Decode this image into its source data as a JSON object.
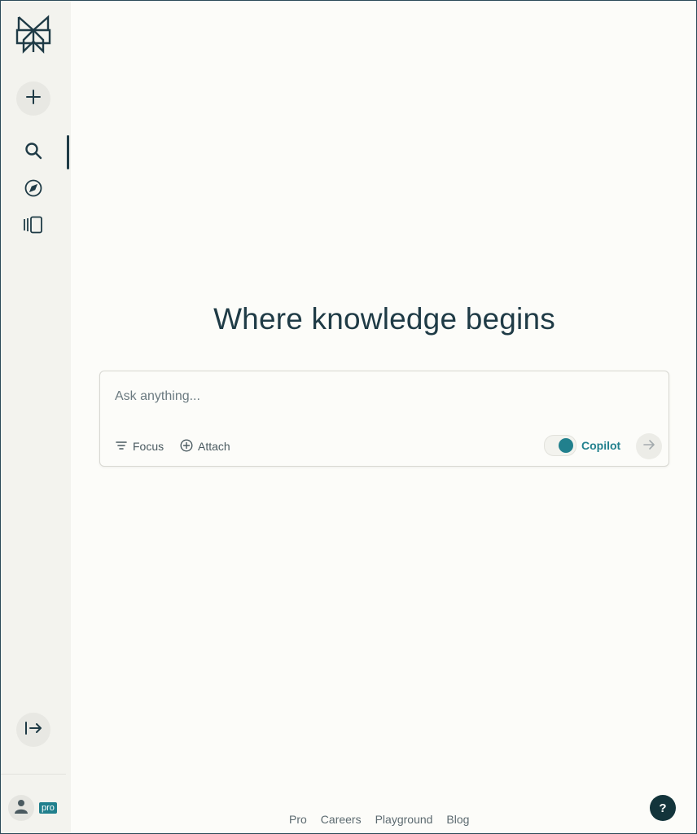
{
  "sidebar": {
    "logo_icon": "perplexity-logo-icon",
    "new_thread_icon": "plus-icon",
    "nav": [
      {
        "name": "search",
        "icon": "search-icon",
        "active": true
      },
      {
        "name": "discover",
        "icon": "compass-icon",
        "active": false
      },
      {
        "name": "library",
        "icon": "library-icon",
        "active": false
      }
    ],
    "collapse_icon": "expand-arrow-icon",
    "user_icon": "user-icon",
    "pro_badge": "pro"
  },
  "main": {
    "headline": "Where knowledge begins",
    "search": {
      "placeholder": "Ask anything...",
      "value": "",
      "focus_label": "Focus",
      "attach_label": "Attach",
      "copilot_label": "Copilot",
      "copilot_enabled": true
    }
  },
  "footer": {
    "links": [
      "Pro",
      "Careers",
      "Playground",
      "Blog"
    ],
    "help_label": "?"
  },
  "colors": {
    "accent": "#21808d",
    "text_dark": "#1f3b46",
    "sidebar_bg": "#f3f3ee",
    "page_bg": "#fcfcf9",
    "help_bg": "#13343b"
  }
}
